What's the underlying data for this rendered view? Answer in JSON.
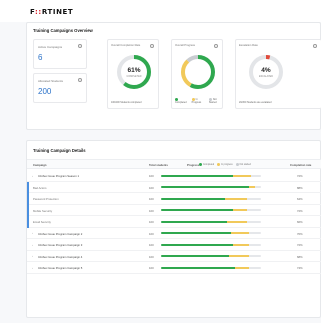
{
  "brand": {
    "logo_a": "F",
    "logo_red": "::",
    "logo_b": "RTINET"
  },
  "overview": {
    "title": "Training Campaigns Overview",
    "active_campaigns_label": "Active Campaigns",
    "active_campaigns_value": "6",
    "allocated_students_label": "Allocated Students",
    "allocated_students_value": "200",
    "completion_card": {
      "title": "Overall Completion Rate",
      "percent_label": "61%",
      "status": "COMPLETED",
      "percent": 0.61,
      "footer": "100/200 Students completed"
    },
    "progress_card": {
      "title": "Overall Progress",
      "segments": [
        {
          "label": "Completed",
          "fraction": 0.58,
          "color": "#2fa84f"
        },
        {
          "label": "In Progress",
          "fraction": 0.3,
          "color": "#f1c95a"
        },
        {
          "label": "Not Started",
          "fraction": 0.12,
          "color": "#c9ccd1"
        }
      ]
    },
    "escalation_card": {
      "title": "Escalation Rate",
      "percent_label": "4%",
      "status": "ESCALATED",
      "percent": 0.04,
      "footer": "20/200 Students are escalated"
    }
  },
  "details": {
    "title": "Training Campaign Details",
    "columns": {
      "campaign": "Campaign",
      "total": "Total students",
      "progress": "Progress",
      "completion": "Completion rate"
    },
    "legend": [
      {
        "label": "Completed",
        "color": "#2fa84f"
      },
      {
        "label": "In progress",
        "color": "#f1c95a"
      },
      {
        "label": "Not started",
        "color": "#c9ccd1"
      }
    ],
    "rows": [
      {
        "name": "InfoSec Issue Program Season 1",
        "total": "100",
        "completed": 0.72,
        "in_progress": 0.18,
        "completion": "72%",
        "kind": "parent"
      },
      {
        "name": "Bad Actors",
        "total": "100",
        "completed": 0.88,
        "in_progress": 0.06,
        "completion": "88%",
        "kind": "sub"
      },
      {
        "name": "Password Protection",
        "total": "100",
        "completed": 0.64,
        "in_progress": 0.22,
        "completion": "64%",
        "kind": "sub"
      },
      {
        "name": "Mobile Security",
        "total": "100",
        "completed": 0.72,
        "in_progress": 0.14,
        "completion": "72%",
        "kind": "sub"
      },
      {
        "name": "Email Security",
        "total": "100",
        "completed": 0.66,
        "in_progress": 0.2,
        "completion": "66%",
        "kind": "sub"
      },
      {
        "name": "InfoSec Issue Program Campaign 2",
        "total": "100",
        "completed": 0.7,
        "in_progress": 0.18,
        "completion": "70%",
        "kind": "parent"
      },
      {
        "name": "InfoSec Issue Program Campaign 3",
        "total": "100",
        "completed": 0.72,
        "in_progress": 0.16,
        "completion": "72%",
        "kind": "parent"
      },
      {
        "name": "InfoSec Issue Program Campaign 4",
        "total": "100",
        "completed": 0.68,
        "in_progress": 0.2,
        "completion": "68%",
        "kind": "parent"
      },
      {
        "name": "InfoSec Issue Program Campaign 5",
        "total": "100",
        "completed": 0.74,
        "in_progress": 0.14,
        "completion": "74%",
        "kind": "parent"
      }
    ]
  }
}
